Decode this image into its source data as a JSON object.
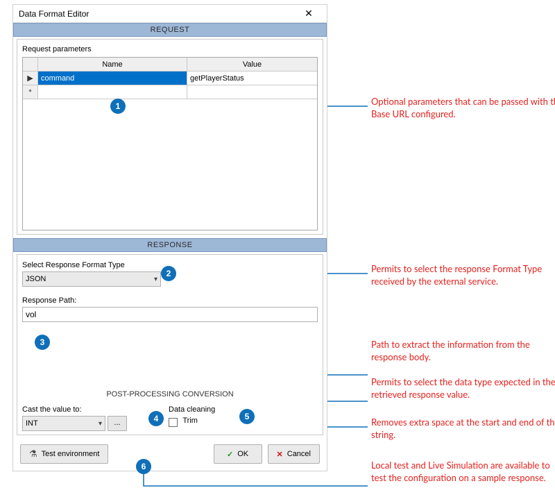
{
  "dialog": {
    "title": "Data Format Editor"
  },
  "request": {
    "header": "REQUEST",
    "subtitle": "Request parameters",
    "columns": {
      "name": "Name",
      "value": "Value"
    },
    "rows": [
      {
        "indicator": "▶",
        "name": "command",
        "value": "getPlayerStatus"
      },
      {
        "indicator": "*",
        "name": "",
        "value": ""
      }
    ]
  },
  "response": {
    "header": "RESPONSE",
    "formatTypeLabel": "Select Response Format Type",
    "formatTypeValue": "JSON",
    "pathLabel": "Response Path:",
    "pathValue": "vol",
    "postHeader": "POST-PROCESSING CONVERSION",
    "castLabel": "Cast the value to:",
    "castValue": "INT",
    "dotsLabel": "...",
    "cleanLabel": "Data cleaning",
    "trimLabel": "Trim"
  },
  "buttons": {
    "test": "Test environment",
    "ok": "OK",
    "cancel": "Cancel"
  },
  "callouts": {
    "n1": "1",
    "n2": "2",
    "n3": "3",
    "n4": "4",
    "n5": "5",
    "n6": "6",
    "t1": "Optional parameters that can be passed with the Base URL configured.",
    "t2": "Permits to select the response Format Type received by the external service.",
    "t3": "Path to extract the information from the response body.",
    "t4": "Permits to select the data type expected in the retrieved response value.",
    "t5": "Removes extra space at the start and end of the string.",
    "t6": "Local test and Live Simulation are available to test the configuration on a sample response."
  }
}
